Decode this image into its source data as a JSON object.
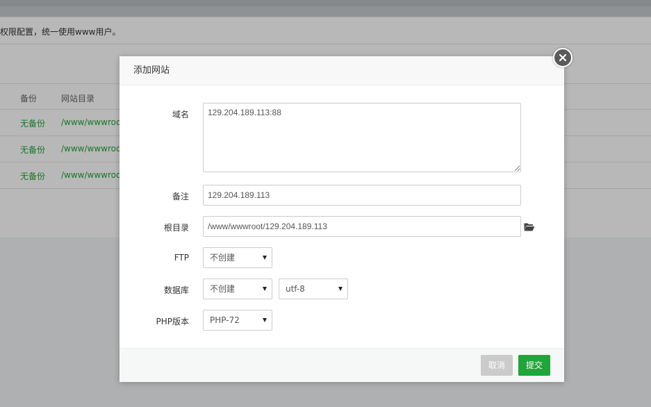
{
  "background": {
    "notice": "权限配置，统一使用www用户。",
    "table": {
      "headers": [
        "备份",
        "网站目录"
      ],
      "rows": [
        {
          "backup": "无备份",
          "dir": "/www/wwwroot"
        },
        {
          "backup": "无备份",
          "dir": "/www/wwwroot"
        },
        {
          "backup": "无备份",
          "dir": "/www/wwwroot"
        }
      ]
    }
  },
  "modal": {
    "title": "添加网站",
    "close_icon": "close-icon",
    "fields": {
      "domain": {
        "label": "域名",
        "value": "129.204.189.113:88"
      },
      "remark": {
        "label": "备注",
        "value": "129.204.189.113"
      },
      "root": {
        "label": "根目录",
        "value": "/www/wwwroot/129.204.189.113",
        "icon": "folder-open-icon"
      },
      "ftp": {
        "label": "FTP",
        "value": "不创建"
      },
      "database": {
        "label": "数据库",
        "value": "不创建",
        "charset": "utf-8"
      },
      "php": {
        "label": "PHP版本",
        "value": "PHP-72"
      }
    },
    "buttons": {
      "cancel": "取消",
      "submit": "提交"
    }
  },
  "colors": {
    "accent": "#20a53a",
    "cancel": "#cbcbcb",
    "close": "#5a5a5a"
  }
}
